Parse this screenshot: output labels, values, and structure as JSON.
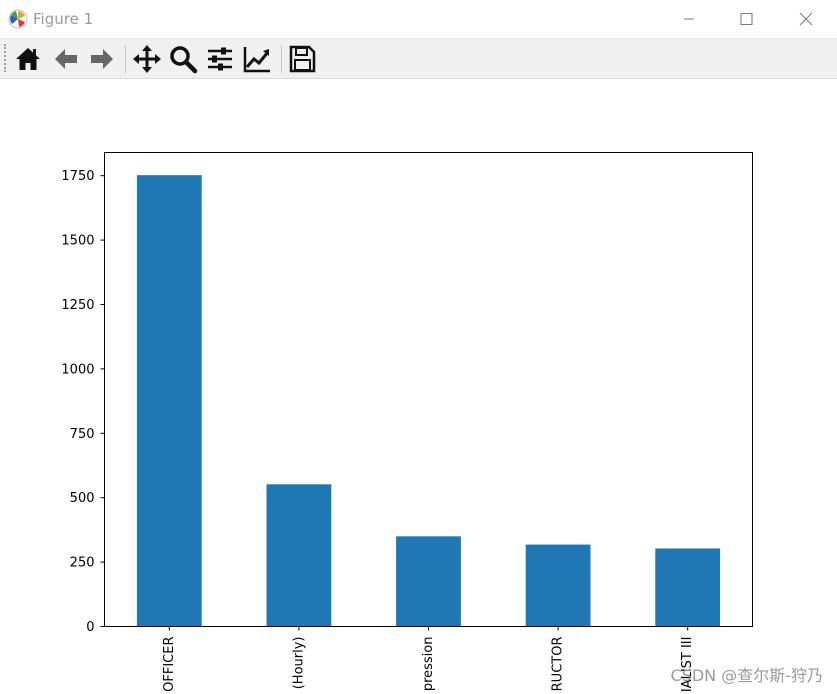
{
  "window": {
    "title": "Figure 1",
    "controls": [
      "minimize-icon",
      "maximize-icon",
      "close-icon"
    ]
  },
  "toolbar": {
    "buttons": [
      {
        "icon": "home-icon"
      },
      {
        "icon": "back-arrow-icon"
      },
      {
        "icon": "forward-arrow-icon"
      },
      {
        "icon": "pan-move-icon"
      },
      {
        "icon": "zoom-magnifier-icon"
      },
      {
        "icon": "configure-subplots-icon"
      },
      {
        "icon": "edit-axis-line-icon"
      },
      {
        "icon": "save-floppy-icon"
      }
    ]
  },
  "colors": {
    "bar": "#1f77b4",
    "toolbar_bg": "#f0f0f0"
  },
  "chart_data": {
    "type": "bar",
    "categories": [
      "OFFICER",
      "(Hourly)",
      "pression",
      "RUCTOR",
      "IALIST III"
    ],
    "values": [
      1752,
      552,
      350,
      318,
      303
    ],
    "ylim": [
      0,
      1840
    ],
    "yticks": [
      0,
      250,
      500,
      750,
      1000,
      1250,
      1500,
      1750
    ],
    "title": "",
    "xlabel": "",
    "ylabel": "",
    "grid": false,
    "legend": "none",
    "xtick_rotation": 90
  },
  "watermark": "CSDN @查尔斯-狩乃"
}
